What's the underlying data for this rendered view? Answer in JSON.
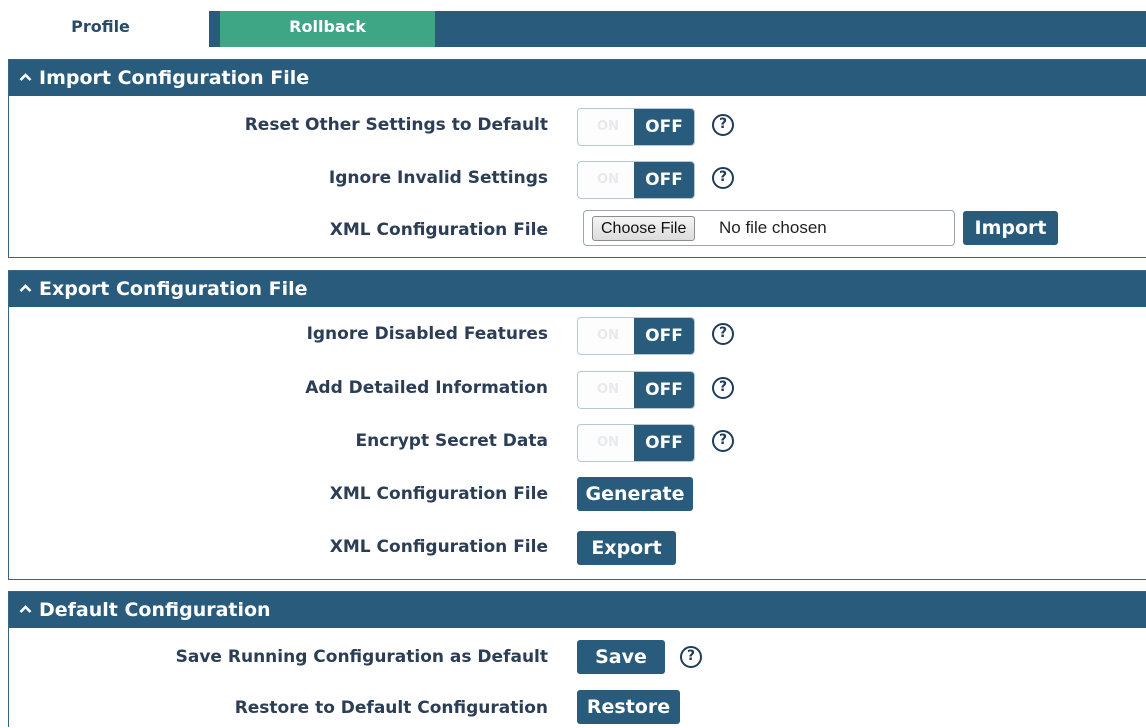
{
  "tabs": {
    "profile": "Profile",
    "rollback": "Rollback"
  },
  "colors": {
    "header": "#285b7c",
    "rollback_tab": "#3ea585",
    "text": "#2b3e55"
  },
  "icons": {
    "section_toggle": "chevron-up-icon",
    "help": "help-circle-icon"
  },
  "import_section": {
    "title": "Import Configuration File",
    "reset_label": "Reset Other Settings to Default",
    "ignore_invalid_label": "Ignore Invalid Settings",
    "xml_label": "XML Configuration File",
    "choose_file": "Choose File",
    "file_status": "No file chosen",
    "import_button": "Import"
  },
  "export_section": {
    "title": "Export Configuration File",
    "ignore_disabled_label": "Ignore Disabled Features",
    "add_detailed_label": "Add Detailed Information",
    "encrypt_label": "Encrypt Secret Data",
    "generate_label": "XML Configuration File",
    "generate_button": "Generate",
    "export_label": "XML Configuration File",
    "export_button": "Export"
  },
  "default_section": {
    "title": "Default Configuration",
    "save_label": "Save Running Configuration as Default",
    "save_button": "Save",
    "restore_label": "Restore to Default Configuration",
    "restore_button": "Restore"
  },
  "toggle": {
    "on": "ON",
    "off": "OFF"
  },
  "help_glyph": "?"
}
